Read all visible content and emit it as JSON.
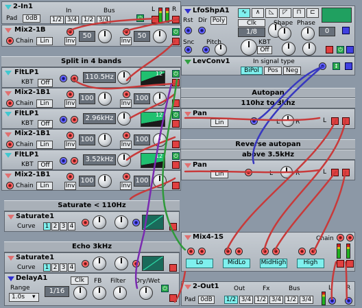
{
  "in2": {
    "name": "2-In1",
    "pad_label": "Pad",
    "pad_value": "0dB",
    "in_label": "In",
    "bus_label": "Bus",
    "btns": [
      "1/2",
      "3/4",
      "1/2",
      "3/4"
    ],
    "l": "L",
    "r": "R"
  },
  "mix_top": {
    "name": "Mix2-1B",
    "chain_label": "Chain",
    "chain_value": "Lin",
    "v1": "50",
    "v2": "50",
    "inv1": "Inv",
    "inv2": "Inv"
  },
  "split_header": "Split in 4 bands",
  "filters": [
    {
      "name": "FltLP1",
      "kbt": "KBT",
      "off": "Off",
      "value": "110.5Hz",
      "badge": "12"
    },
    {
      "name": "FltLP1",
      "kbt": "KBT",
      "off": "Off",
      "value": "2.96kHz",
      "badge": "12"
    },
    {
      "name": "FltLP1",
      "kbt": "KBT",
      "off": "Off",
      "value": "3.52kHz",
      "badge": "12"
    }
  ],
  "mixers": [
    {
      "name": "Mix2-1B1",
      "chain_label": "Chain",
      "chain_value": "Lin",
      "inv1": "Inv",
      "inv2": "Inv",
      "v1": "100",
      "v2": "100"
    },
    {
      "name": "Mix2-1B1",
      "chain_label": "Chain",
      "chain_value": "Lin",
      "inv1": "Inv",
      "inv2": "Inv",
      "v1": "100",
      "v2": "100"
    },
    {
      "name": "Mix2-1B1",
      "chain_label": "Chain",
      "chain_value": "Lin",
      "inv1": "Inv",
      "inv2": "Inv",
      "v1": "100",
      "v2": "100"
    }
  ],
  "sat_header": "Saturate < 110Hz",
  "saturate1": {
    "name": "Saturate1",
    "curve_label": "Curve",
    "curves": [
      "1",
      "2",
      "3",
      "4"
    ]
  },
  "echo_header": "Echo 3kHz",
  "saturate2": {
    "name": "Saturate1",
    "curve_label": "Curve",
    "curves": [
      "1",
      "2",
      "3",
      "4"
    ]
  },
  "delay": {
    "name": "DelayA1",
    "range_label": "Range",
    "range_value": "1.0s",
    "clk": "Clk",
    "fb": "FB",
    "filter": "Filter",
    "drywet": "Dry/Wet",
    "time": "1/16"
  },
  "lfo": {
    "name": "LfoShpA1",
    "rst": "Rst",
    "dir": "Dir",
    "poly": "Poly",
    "clk": "Clk",
    "rate": "1/8",
    "shape": "Shape",
    "phase": "Phase",
    "phase_value": "0",
    "snc": "Snc",
    "pitch": "Pitch",
    "kbt": "KBT",
    "off": "Off"
  },
  "lev": {
    "name": "LevConv1",
    "in_signal": "In signal type",
    "types": [
      "BiPol",
      "Pos",
      "Neg"
    ]
  },
  "autopan_header": "Autopan",
  "autopan_sub": "110hz to 3khz",
  "pan1": {
    "name": "Pan",
    "mode": "Lin",
    "l": "L",
    "r": "R"
  },
  "rev_header": "Reverse autopan",
  "rev_sub": "above 3.5kHz",
  "pan2": {
    "name": "Pan",
    "mode": "Lin",
    "l": "L",
    "r": "R"
  },
  "mix4": {
    "name": "Mix4-1S",
    "chain": "Chain",
    "bands": [
      "Lo",
      "MidLo",
      "MidHigh",
      "High"
    ],
    "l": "L",
    "r": "R"
  },
  "out2": {
    "name": "2-Out1",
    "pad_label": "Pad",
    "pad_value": "0dB",
    "out_label": "Out",
    "fx_label": "Fx",
    "bus_label": "Bus",
    "btns": [
      "1/2",
      "3/4",
      "1/2",
      "3/4",
      "1/2",
      "3/4"
    ],
    "l": "L",
    "r": "R"
  },
  "colors": {
    "bg": "#8c98a6",
    "panel": "#bac1c8",
    "cyan": "#7ff0ee",
    "cable_red": "#c83a3a",
    "cable_blue": "#3838c0",
    "cable_green": "#2e9a3a",
    "cable_purple": "#7a2ab0"
  }
}
